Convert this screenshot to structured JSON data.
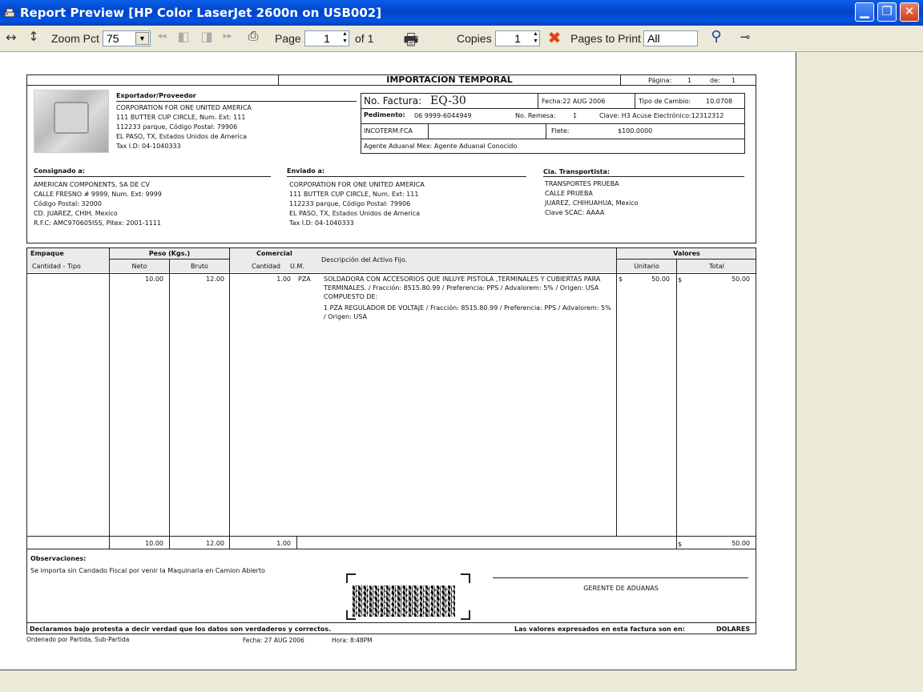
{
  "window": {
    "title": "Report Preview   [HP Color LaserJet 2600n on USB002]"
  },
  "toolbar": {
    "zoom_label": "Zoom Pct",
    "zoom_value": "75",
    "page_label": "Page",
    "page_value": "1",
    "of_label": "of 1",
    "copies_label": "Copies",
    "copies_value": "1",
    "pages_label": "Pages to Print",
    "pages_value": "All"
  },
  "report": {
    "title": "IMPORTACION TEMPORAL",
    "pagina_label": "Página:",
    "pagina": "1",
    "de_label": "de:",
    "de": "1",
    "exportador": {
      "heading": "Exportador/Proveedor",
      "lines": [
        "CORPORATION FOR ONE UNITED AMERICA",
        "111 BUTTER CUP CIRCLE, Num. Ext: 111",
        "112233 parque, Código Postal: 79906",
        "EL PASO, TX, Estados Unidos de America",
        "Tax I.D: 04-1040333"
      ]
    },
    "factura": {
      "label": "No. Factura:",
      "value": "EQ-30",
      "fecha": "Fecha:22 AUG 2006",
      "tipo_cambio_label": "Tipo de Cambio:",
      "tipo_cambio": "10.0708",
      "pedimento_label": "Pedimento:",
      "pedimento": "06  9999-6044949",
      "remesa_label": "No. Remesa:",
      "remesa": "1",
      "clave": "Clave: H3 Acuse Electrónico:12312312",
      "incoterm": "INCOTERM:FCA",
      "flete_label": "Flete:",
      "flete": "$100.0000",
      "agente": "Agente Aduanal Mex:  Agente Aduanal Conocido"
    },
    "consignado": {
      "heading": "Consignado a:",
      "lines": [
        "AMERICAN COMPONENTS, SA DE CV",
        "CALLE FRESNO # 9999, Num. Ext: 9999",
        "Código Postal: 32000",
        "CD. JUAREZ, CHIH, Mexico",
        "R.F.C: AMC970605ISS, Pitex: 2001-1111"
      ]
    },
    "enviado": {
      "heading": "Enviado a:",
      "lines": [
        "CORPORATION FOR ONE UNITED AMERICA",
        "111 BUTTER CUP CIRCLE, Num. Ext: 111",
        "112233 parque, Código Postal: 79906",
        "EL PASO, TX, Estados Unidos de America",
        "Tax I.D: 04-1040333"
      ]
    },
    "transportista": {
      "heading": "Cia. Transportista:",
      "lines": [
        "TRANSPORTES PRUEBA",
        "CALLE PRUEBA",
        "JUAREZ, CHIHUAHUA, Mexico",
        "Clave SCAC: AAAA"
      ]
    },
    "table": {
      "h_empaque": "Empaque",
      "h_cantidad_tipo": "Cantidad - Tipo",
      "h_peso": "Peso (Kgs.)",
      "h_neto": "Neto",
      "h_bruto": "Bruto",
      "h_comercial": "Comercial",
      "h_cantidad": "Cantidad",
      "h_um": "U.M.",
      "h_desc": "Descripción del Activo Fijo.",
      "h_valores": "Valores",
      "h_unitario": "Unitario",
      "h_total": "Total",
      "row": {
        "neto": "10.00",
        "bruto": "12.00",
        "cantidad": "1.00",
        "um": "PZA",
        "desc1": "SOLDADORA CON ACCESORIOS QUE INLUYE PISTOLA ,TERMINALES Y CUBIERTAS PARA TERMINALES. / Fracción: 8515.80.99 / Preferencia: PPS / Advalorem: 5% / Origen: USA",
        "desc2": "COMPUESTO DE:",
        "desc3": "1  PZA   REGULADOR DE VOLTAJE / Fracción: 8515.80.99 / Preferencia: PPS / Advalorem: 5% / Origen: USA",
        "unit_cur": "$",
        "unitario": "50.00",
        "total_cur": "$",
        "total": "50.00"
      },
      "totals": {
        "neto": "10.00",
        "bruto": "12.00",
        "cantidad": "1.00",
        "cur": "$",
        "total": "50.00"
      }
    },
    "observaciones": {
      "heading": "Observaciones:",
      "text": "Se importa sin Candado Fiscal por venir la Maquinaria en Camion Abierto"
    },
    "firma": "GERENTE DE ADUANAS",
    "declaracion": "Declaramos bajo protesta a decir verdad que los datos son verdaderos y correctos.",
    "valores_exp": "Las valores expresados en esta factura son en:",
    "moneda": "DOLARES",
    "footer": {
      "orden": "Ordenado por Partida, Sub-Partida",
      "fecha": "Fecha:  27 AUG 2006",
      "hora": "Hora:    8:48PM"
    }
  }
}
